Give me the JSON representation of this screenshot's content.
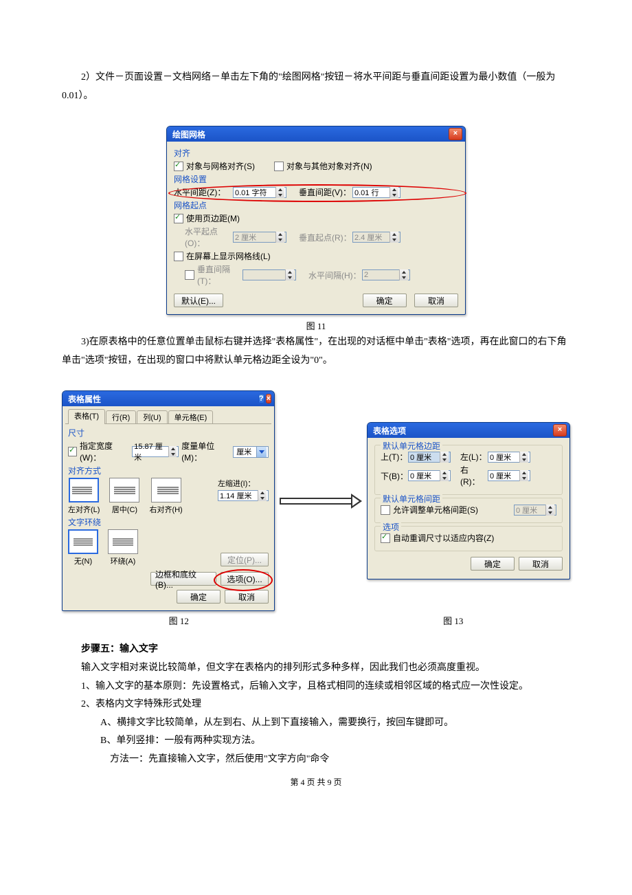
{
  "text": {
    "para1": "2）文件－页面设置－文档网络－单击左下角的\"绘图网格\"按钮－将水平间距与垂直间距设置为最小数值（一般为 0.01）。",
    "cap11": "图 11",
    "para2": "3)在原表格中的任意位置单击鼠标右键并选择\"表格属性\"，在出现的对话框中单击\"表格\"选项，再在此窗口的右下角单击\"选项\"按钮，在出现的窗口中将默认单元格边距全设为\"0\"。",
    "cap12": "图 12",
    "cap13": "图 13",
    "step5": "步骤五：输入文字",
    "p3": "输入文字相对来说比较简单，但文字在表格内的排列形式多种多样，因此我们也必须高度重视。",
    "p4": "1、输入文字的基本原则：先设置格式，后输入文字，且格式相同的连续或相邻区域的格式应一次性设定。",
    "p5": "2、表格内文字特殊形式处理",
    "p5a": "A、横排文字比较简单，从左到右、从上到下直接输入，需要换行，按回车键即可。",
    "p5b": "B、单列竖排：一般有两种实现方法。",
    "p5b1": "方法一：先直接输入文字，然后使用\"文字方向\"命令",
    "footer": "第 4 页 共 9 页"
  },
  "dlg1": {
    "title": "绘图网格",
    "sec_align": "对齐",
    "chk_snap_grid": "对象与网格对齐(S)",
    "chk_snap_obj": "对象与其他对象对齐(N)",
    "sec_grid": "网格设置",
    "h_label": "水平间距(Z)：",
    "h_val": "0.01 字符",
    "v_label": "垂直间距(V)：",
    "v_val": "0.01 行",
    "sec_origin": "网格起点",
    "chk_margin": "使用页边距(M)",
    "ho_label": "水平起点(O)：",
    "ho_val": "2 厘米",
    "vo_label": "垂直起点(R)：",
    "vo_val": "2.4 厘米",
    "chk_show": "在屏幕上显示网格线(L)",
    "vi_label": "垂直间隔(T)：",
    "hi_label": "水平间隔(H)：",
    "hi_val": "2",
    "btn_default": "默认(E)...",
    "btn_ok": "确定",
    "btn_cancel": "取消"
  },
  "dlg2": {
    "title": "表格属性",
    "tab_table": "表格(T)",
    "tab_row": "行(R)",
    "tab_col": "列(U)",
    "tab_cell": "单元格(E)",
    "sec_size": "尺寸",
    "chk_width": "指定宽度(W)：",
    "width_val": "15.87 厘米",
    "unit_label": "度量单位(M)：",
    "unit_val": "厘米",
    "sec_align": "对齐方式",
    "align_left": "左对齐(L)",
    "align_center": "居中(C)",
    "align_right": "右对齐(H)",
    "indent_label": "左缩进(I)：",
    "indent_val": "1.14 厘米",
    "sec_wrap": "文字环绕",
    "wrap_none": "无(N)",
    "wrap_around": "环绕(A)",
    "btn_pos": "定位(P)...",
    "btn_border": "边框和底纹(B)...",
    "btn_options": "选项(O)...",
    "btn_ok": "确定",
    "btn_cancel": "取消"
  },
  "dlg3": {
    "title": "表格选项",
    "sec_margin": "默认单元格边距",
    "top_l": "上(T)：",
    "top_v": "0 厘米",
    "left_l": "左(L)：",
    "left_v": "0 厘米",
    "bot_l": "下(B)：",
    "bot_v": "0 厘米",
    "right_l": "右(R)：",
    "right_v": "0 厘米",
    "sec_spacing": "默认单元格间距",
    "chk_spacing": "允许调整单元格间距(S)",
    "spacing_val": "0 厘米",
    "sec_opts": "选项",
    "chk_auto": "自动重调尺寸以适应内容(Z)",
    "btn_ok": "确定",
    "btn_cancel": "取消"
  }
}
